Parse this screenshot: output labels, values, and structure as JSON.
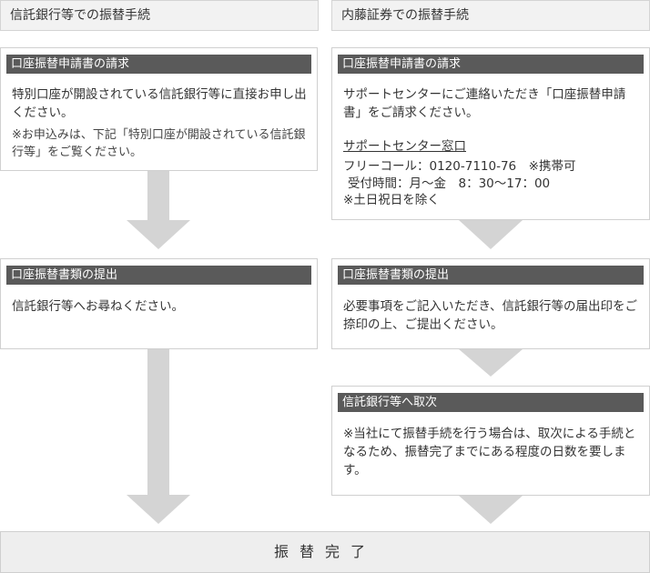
{
  "left_column": {
    "header": "信託銀行等での振替手続",
    "step1": {
      "title": "口座振替申請書の請求",
      "body": "特別口座が開設されている信託銀行等に直接お申し出ください。",
      "note": "※お申込みは、下記「特別口座が開設されている信託銀行等」をご覧ください。"
    },
    "step2": {
      "title": "口座振替書類の提出",
      "body": "信託銀行等へお尋ねください。"
    }
  },
  "right_column": {
    "header": "内藤証券での振替手続",
    "step1": {
      "title": "口座振替申請書の請求",
      "body": "サポートセンターにご連絡いただき「口座振替申請書」をご請求ください。",
      "contact_heading": "サポートセンター窓口",
      "contact_line1": "フリーコール：0120-7110-76　※携帯可",
      "contact_line2": "受付時間：月～金　8：30～17：00",
      "contact_line3": "※土日祝日を除く"
    },
    "step2": {
      "title": "口座振替書類の提出",
      "body": "必要事項をご記入いただき、信託銀行等の届出印をご捺印の上、ご提出ください。"
    },
    "step3": {
      "title": "信託銀行等へ取次",
      "body": "※当社にて振替手続を行う場合は、取次による手続となるため、振替完了までにある程度の日数を要します。"
    }
  },
  "final": {
    "label": "振替完了"
  },
  "colors": {
    "title_bar": "#5a5a5a",
    "arrow": "#d4d4d4",
    "header_bg": "#f2f2f2",
    "final_bg": "#eeeeee"
  }
}
